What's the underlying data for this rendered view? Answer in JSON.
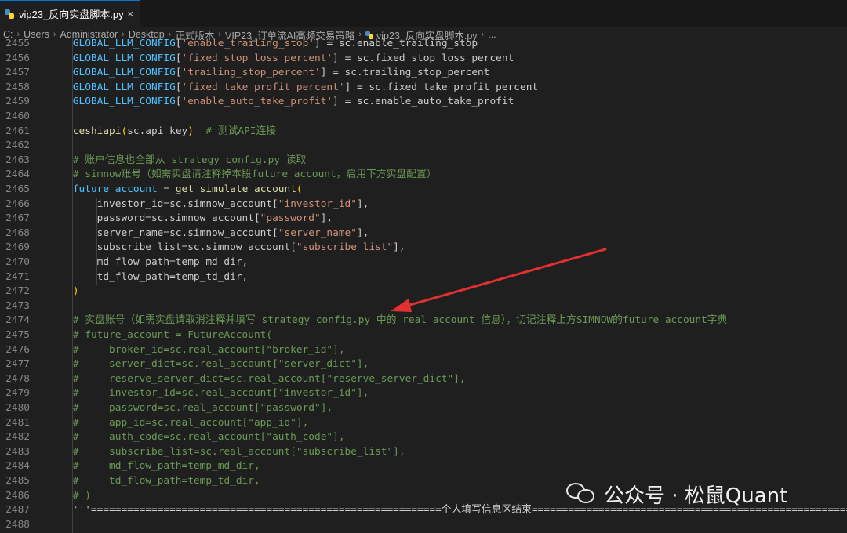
{
  "tab": {
    "filename": "vip23_反向实盘脚本.py",
    "close_icon": "×"
  },
  "breadcrumb": [
    "C:",
    "Users",
    "Administrator",
    "Desktop",
    "正式版本",
    "VIP23_订单流AI高频交易策略",
    "vip23_反向实盘脚本.py",
    "..."
  ],
  "colors": {
    "background": "#1f1f1f",
    "variable": "#4fc1ff",
    "string": "#ce9178",
    "comment": "#6a9955",
    "function": "#dcdcaa",
    "arrow": "#e03030"
  },
  "lines": [
    {
      "n": "2455",
      "code": "    GLOBAL_LLM_CONFIG['enable_trailing_stop'] = sc.enable_trailing_stop"
    },
    {
      "n": "2456",
      "code": "    GLOBAL_LLM_CONFIG['fixed_stop_loss_percent'] = sc.fixed_stop_loss_percent"
    },
    {
      "n": "2457",
      "code": "    GLOBAL_LLM_CONFIG['trailing_stop_percent'] = sc.trailing_stop_percent"
    },
    {
      "n": "2458",
      "code": "    GLOBAL_LLM_CONFIG['fixed_take_profit_percent'] = sc.fixed_take_profit_percent"
    },
    {
      "n": "2459",
      "code": "    GLOBAL_LLM_CONFIG['enable_auto_take_profit'] = sc.enable_auto_take_profit"
    },
    {
      "n": "2460",
      "code": ""
    },
    {
      "n": "2461",
      "code": "    ceshiapi(sc.api_key)  # 测试API连接"
    },
    {
      "n": "2462",
      "code": ""
    },
    {
      "n": "2463",
      "code": "    # 账户信息也全部从 strategy_config.py 读取"
    },
    {
      "n": "2464",
      "code": "    # simnow账号（如需实盘请注释掉本段future_account，启用下方实盘配置）"
    },
    {
      "n": "2465",
      "code": "    future_account = get_simulate_account("
    },
    {
      "n": "2466",
      "code": "        investor_id=sc.simnow_account[\"investor_id\"],"
    },
    {
      "n": "2467",
      "code": "        password=sc.simnow_account[\"password\"],"
    },
    {
      "n": "2468",
      "code": "        server_name=sc.simnow_account[\"server_name\"],"
    },
    {
      "n": "2469",
      "code": "        subscribe_list=sc.simnow_account[\"subscribe_list\"],"
    },
    {
      "n": "2470",
      "code": "        md_flow_path=temp_md_dir,"
    },
    {
      "n": "2471",
      "code": "        td_flow_path=temp_td_dir,"
    },
    {
      "n": "2472",
      "code": "    )"
    },
    {
      "n": "2473",
      "code": ""
    },
    {
      "n": "2474",
      "code": "    # 实盘账号（如需实盘请取消注释并填写 strategy_config.py 中的 real_account 信息），切记注释上方SIMNOW的future_account字典"
    },
    {
      "n": "2475",
      "code": "    # future_account = FutureAccount("
    },
    {
      "n": "2476",
      "code": "    #     broker_id=sc.real_account[\"broker_id\"],"
    },
    {
      "n": "2477",
      "code": "    #     server_dict=sc.real_account[\"server_dict\"],"
    },
    {
      "n": "2478",
      "code": "    #     reserve_server_dict=sc.real_account[\"reserve_server_dict\"],"
    },
    {
      "n": "2479",
      "code": "    #     investor_id=sc.real_account[\"investor_id\"],"
    },
    {
      "n": "2480",
      "code": "    #     password=sc.real_account[\"password\"],"
    },
    {
      "n": "2481",
      "code": "    #     app_id=sc.real_account[\"app_id\"],"
    },
    {
      "n": "2482",
      "code": "    #     auth_code=sc.real_account[\"auth_code\"],"
    },
    {
      "n": "2483",
      "code": "    #     subscribe_list=sc.real_account[\"subscribe_list\"],"
    },
    {
      "n": "2484",
      "code": "    #     md_flow_path=temp_md_dir,"
    },
    {
      "n": "2485",
      "code": "    #     td_flow_path=temp_td_dir,"
    },
    {
      "n": "2486",
      "code": "    # )"
    },
    {
      "n": "2487",
      "code": "    '''==========================================================个人填写信息区结束======================================================"
    },
    {
      "n": "2488",
      "code": ""
    }
  ],
  "watermark": {
    "text": "公众号 · 松鼠Quant",
    "icon": "wechat-icon"
  }
}
